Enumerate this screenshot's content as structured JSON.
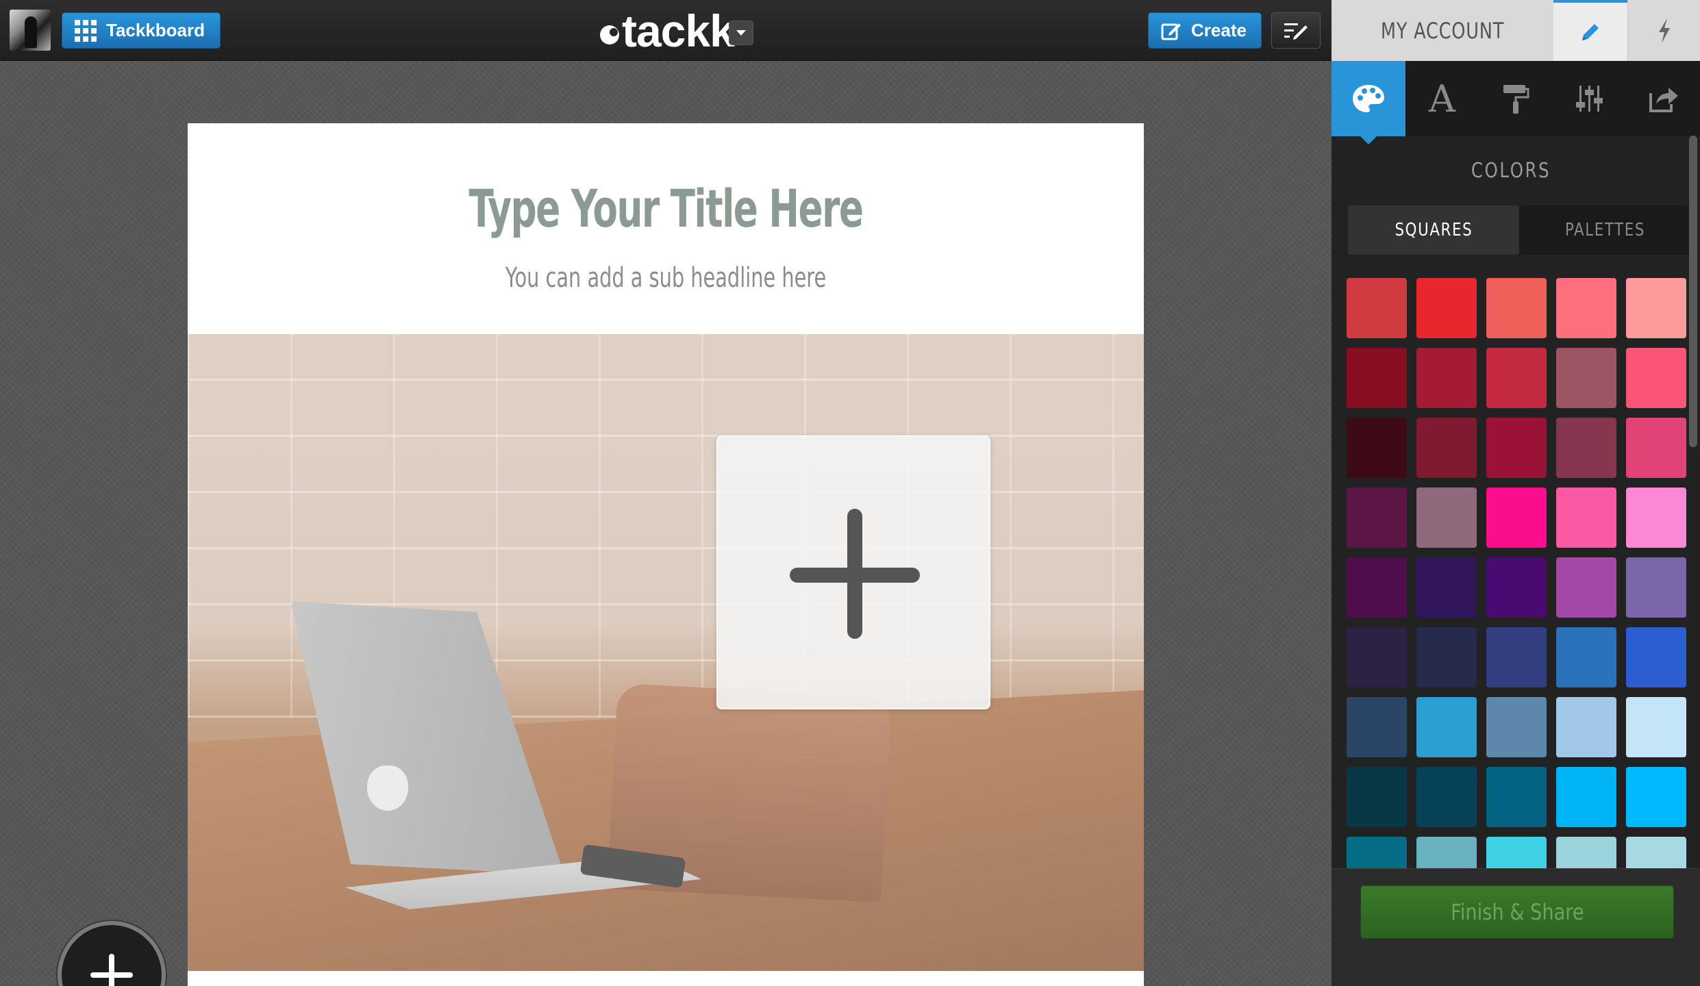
{
  "topbar": {
    "tackkboard_label": "Tackkboard",
    "logo_text": "tackk",
    "create_label": "Create"
  },
  "page": {
    "title_placeholder": "Type Your Title Here",
    "subheadline_placeholder": "You can add a sub headline here"
  },
  "panel": {
    "account_label": "MY ACCOUNT",
    "section_heading": "COLORS",
    "segments": [
      "SQUARES",
      "PALETTES"
    ],
    "active_segment": "SQUARES",
    "finish_label": "Finish & Share",
    "tools": [
      "palette-icon",
      "font-icon",
      "paint-roller-icon",
      "sliders-icon",
      "share-icon"
    ],
    "active_tool": "palette-icon",
    "swatches": [
      "#d13a3f",
      "#e8262f",
      "#f0605a",
      "#fd6f7c",
      "#fd9a9a",
      "#8a0e22",
      "#a61b34",
      "#c32a42",
      "#9e5563",
      "#fb5479",
      "#3e0a18",
      "#801a30",
      "#9a1236",
      "#86364f",
      "#e24377",
      "#5c1646",
      "#8e6a7c",
      "#fb0d8d",
      "#fc59a5",
      "#fd88d5",
      "#4e0d4c",
      "#32165a",
      "#490b72",
      "#a448a8",
      "#7a66a8",
      "#2b2244",
      "#27294d",
      "#323e80",
      "#2a72ba",
      "#2c5ed2",
      "#2a4566",
      "#2b9ed2",
      "#5d87ab",
      "#a1c8e8",
      "#c4e5f7",
      "#083746",
      "#064158",
      "#046382",
      "#01b4f6",
      "#01b9fc",
      "#056d86",
      "#68b2c2",
      "#40d1e6",
      "#9ad3dc",
      "#a7d9e2"
    ]
  },
  "colors": {
    "accent": "#2a94d9",
    "finish_green": "#2c6220"
  }
}
